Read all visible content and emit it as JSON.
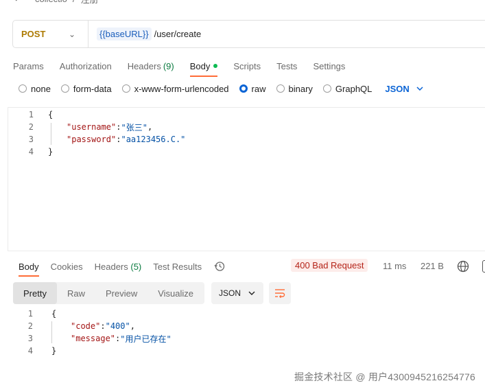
{
  "breadcrumb": {
    "collection": "collectio",
    "request": "注册"
  },
  "request": {
    "method": "POST",
    "url_variable": "{{baseURL}}",
    "url_path": "/user/create"
  },
  "request_tabs": [
    {
      "label": "Params"
    },
    {
      "label": "Authorization"
    },
    {
      "label": "Headers",
      "count": "(9)"
    },
    {
      "label": "Body",
      "active": true
    },
    {
      "label": "Scripts"
    },
    {
      "label": "Tests"
    },
    {
      "label": "Settings"
    }
  ],
  "body_types": [
    {
      "label": "none"
    },
    {
      "label": "form-data"
    },
    {
      "label": "x-www-form-urlencoded"
    },
    {
      "label": "raw",
      "selected": true
    },
    {
      "label": "binary"
    },
    {
      "label": "GraphQL"
    }
  ],
  "raw_format": "JSON",
  "request_body": {
    "line_numbers": [
      "1",
      "2",
      "3",
      "4"
    ],
    "open": "{",
    "key1": "\"username\"",
    "val1": "\"张三\"",
    "key2": "\"password\"",
    "val2": "\"aa123456.C.\"",
    "close": "}"
  },
  "response_tabs": [
    {
      "label": "Body",
      "active": true
    },
    {
      "label": "Cookies"
    },
    {
      "label": "Headers",
      "count": "(5)"
    },
    {
      "label": "Test Results"
    }
  ],
  "response_status": "400 Bad Request",
  "response_time": "11 ms",
  "response_size": "221 B",
  "view_modes": [
    "Pretty",
    "Raw",
    "Preview",
    "Visualize"
  ],
  "response_format": "JSON",
  "response_body": {
    "line_numbers": [
      "1",
      "2",
      "3",
      "4"
    ],
    "open": "{",
    "key1": "\"code\"",
    "val1": "\"400\"",
    "key2": "\"message\"",
    "val2": "\"用户已存在\"",
    "close": "}"
  },
  "watermark": "掘金技术社区 @ 用户4300945216254776",
  "colors": {
    "accent": "#ff6c37",
    "method": "#ad7a03",
    "link": "#0b64d5",
    "error": "#b42318"
  }
}
